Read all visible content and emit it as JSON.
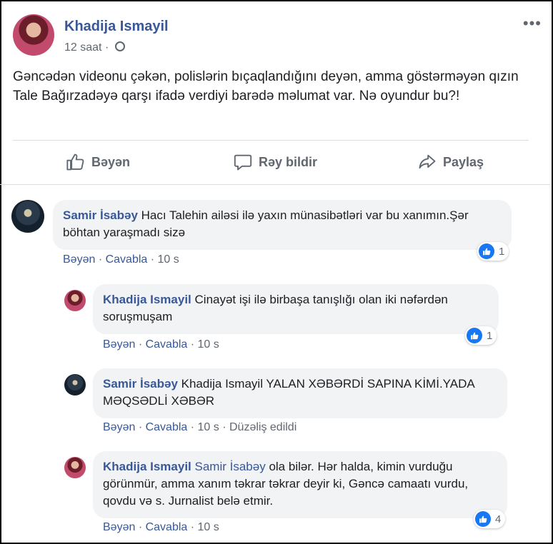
{
  "post": {
    "author": "Khadija Ismayil",
    "time": "12 saat",
    "separator": "·",
    "more": "•••",
    "text": "Gəncədən videonu çəkən, polislərin bıçaqlandığını deyən, amma göstərməyən qızın Tale Bağırzadəyə qarşı ifadə verdiyi barədə məlumat var. Nə oyundur bu?!",
    "actions": {
      "like": "Bəyən",
      "comment": "Rəy bildir",
      "share": "Paylaş"
    }
  },
  "comments": [
    {
      "author": "Samir İsabəy",
      "mention": "",
      "text": "Hacı Talehin ailəsi ilə yaxın münasibətləri var bu xanımın.Şər böhtan yaraşmadı sizə",
      "like": "Bəyən",
      "reply": "Cavabla",
      "time": "10 s",
      "edited": "",
      "reactions": "1"
    },
    {
      "author": "Khadija Ismayil",
      "mention": "",
      "text": "Cinayət işi ilə birbaşa tanışlığı olan iki nəfərdən soruşmuşam",
      "like": "Bəyən",
      "reply": "Cavabla",
      "time": "10 s",
      "edited": "",
      "reactions": "1"
    },
    {
      "author": "Samir İsabəy",
      "mention": "",
      "text": "Khadija Ismayil YALAN XƏBƏRDİ SAPINA KİMİ.YADA MƏQSƏDLİ XƏBƏR",
      "like": "Bəyən",
      "reply": "Cavabla",
      "time": "10 s",
      "edited": "Düzəliş edildi",
      "reactions": ""
    },
    {
      "author": "Khadija Ismayil",
      "mention": "Samir İsabəy",
      "text": "ola bilər. Hər halda, kimin vurduğu görünmür, amma xanım təkrar təkrar deyir ki, Gəncə camaatı vurdu, qovdu və s. Jurnalist belə etmir.",
      "like": "Bəyən",
      "reply": "Cavabla",
      "time": "10 s",
      "edited": "",
      "reactions": "4"
    }
  ],
  "colors": {
    "link": "#385898",
    "bubble": "#f2f3f5",
    "like": "#1877f2",
    "muted": "#606770"
  }
}
